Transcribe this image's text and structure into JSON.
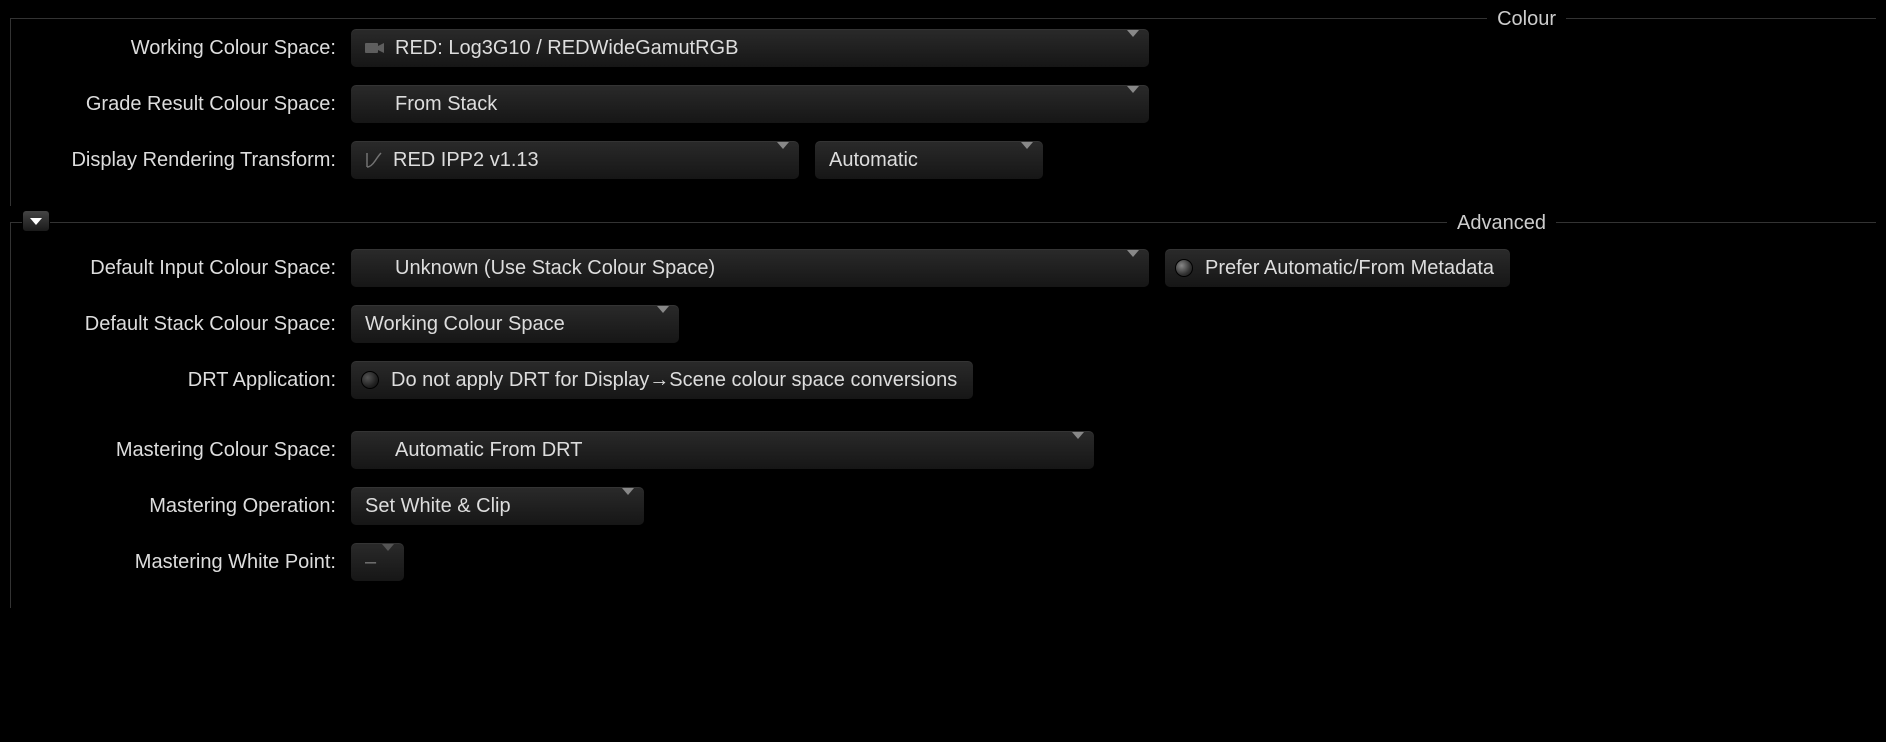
{
  "colour": {
    "title": "Colour",
    "working_colour_space": {
      "label": "Working Colour Space:",
      "value": "RED: Log3G10 / REDWideGamutRGB"
    },
    "grade_result_colour_space": {
      "label": "Grade Result Colour Space:",
      "value": "From Stack"
    },
    "display_rendering_transform": {
      "label": "Display Rendering Transform:",
      "value": "RED IPP2 v1.13",
      "mode": "Automatic"
    }
  },
  "advanced": {
    "title": "Advanced",
    "default_input_colour_space": {
      "label": "Default Input Colour Space:",
      "value": "Unknown (Use Stack Colour Space)",
      "prefer_label": "Prefer Automatic/From Metadata"
    },
    "default_stack_colour_space": {
      "label": "Default Stack Colour Space:",
      "value": "Working Colour Space"
    },
    "drt_application": {
      "label": "DRT Application:",
      "value": "Do not apply DRT for Display→Scene colour space conversions"
    },
    "mastering_colour_space": {
      "label": "Mastering Colour Space:",
      "value": "Automatic From DRT"
    },
    "mastering_operation": {
      "label": "Mastering Operation:",
      "value": "Set White & Clip"
    },
    "mastering_white_point": {
      "label": "Mastering White Point:",
      "value": "–"
    }
  }
}
